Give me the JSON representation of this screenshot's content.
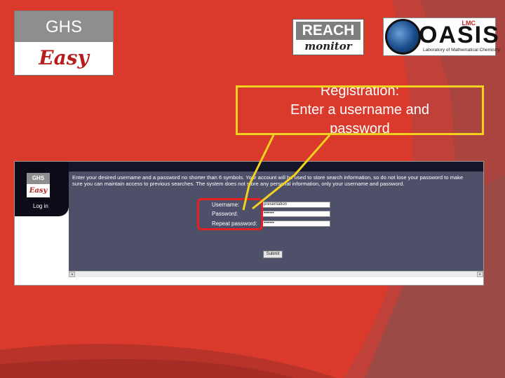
{
  "logos": {
    "ghs": {
      "top": "GHS",
      "bottom": "Easy"
    },
    "reach": {
      "top": "REACH",
      "bottom": "monitor"
    },
    "oasis": {
      "word": "OASIS",
      "tag": "LMC",
      "sub": "Laboratory of Mathematical Chemistry"
    }
  },
  "callout": {
    "line1": "Registration:",
    "line2": "Enter a username and",
    "line3": "password"
  },
  "app": {
    "mini_logo": {
      "top": "GHS",
      "bottom": "Easy"
    },
    "nav_login": "Log in",
    "intro_text": "Enter your desired username and a password no shorter than 6 symbols. Your account will be used to store search information, so do not lose your password to make sure you can maintain access to previous searches. The system does not store any personal information, only your username and password.",
    "form": {
      "username_label": "Username:",
      "username_value": "presentation",
      "password_label": "Password:",
      "password_value": "•••••••",
      "repeat_label": "Repeat password:",
      "repeat_value": "•••••••",
      "submit_label": "Submit"
    }
  },
  "colors": {
    "background": "#d93a2b",
    "callout_border": "#f2d21f",
    "highlight_border": "#e62020",
    "panel": "#4e5069"
  }
}
